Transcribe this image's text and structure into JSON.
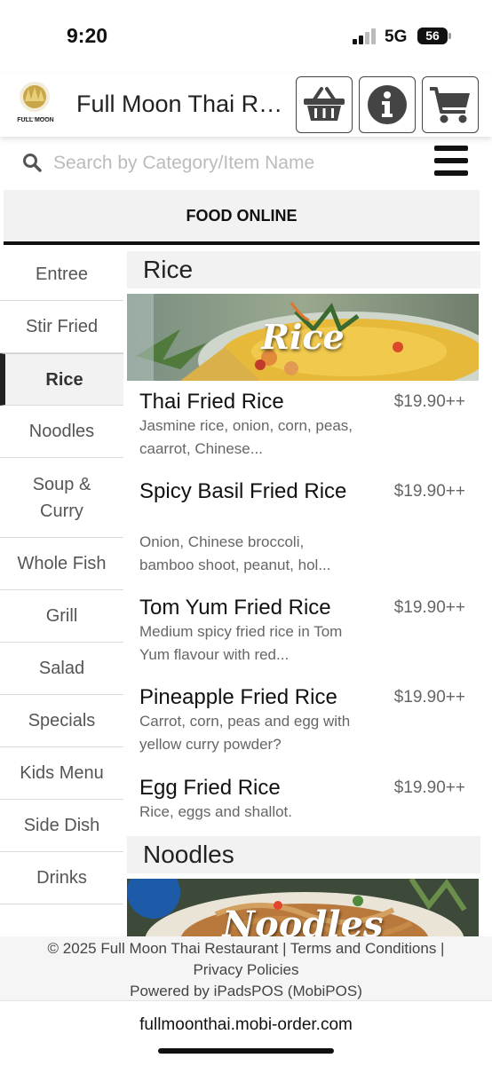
{
  "status_bar": {
    "time": "9:20",
    "network": "5G",
    "battery": "56"
  },
  "header": {
    "store_name": "Full Moon Thai Restaurant",
    "logo_text": "FULL MOON",
    "icons": [
      "basket-icon",
      "info-icon",
      "cart-icon"
    ]
  },
  "search": {
    "placeholder": "Search by Category/Item Name",
    "value": ""
  },
  "tabs": {
    "food_online": "FOOD ONLINE"
  },
  "sidebar": {
    "active": "Rice",
    "items": [
      {
        "label": "Entree"
      },
      {
        "label": "Stir Fried"
      },
      {
        "label": "Rice"
      },
      {
        "label": "Noodles"
      },
      {
        "label": "Soup & Curry"
      },
      {
        "label": "Whole Fish"
      },
      {
        "label": "Grill"
      },
      {
        "label": "Salad"
      },
      {
        "label": "Specials"
      },
      {
        "label": "Kids Menu"
      },
      {
        "label": "Side Dish"
      },
      {
        "label": "Drinks"
      }
    ]
  },
  "menu": {
    "sections": [
      {
        "title": "Rice",
        "banner_text": "Rice",
        "items": [
          {
            "name": "Thai Fried Rice",
            "price": "$19.90++",
            "desc": "Jasmine rice, onion, corn, peas, caarrot, Chinese..."
          },
          {
            "name": "Spicy Basil Fried Rice",
            "price": "$19.90++",
            "desc": "Onion, Chinese broccoli, bamboo shoot, peanut, hol..."
          },
          {
            "name": "Tom Yum Fried Rice",
            "price": "$19.90++",
            "desc": "Medium spicy fried rice in Tom Yum flavour with red..."
          },
          {
            "name": "Pineapple Fried Rice",
            "price": "$19.90++",
            "desc": "Carrot, corn, peas and egg with yellow curry powder?"
          },
          {
            "name": "Egg Fried Rice",
            "price": "$19.90++",
            "desc": "Rice, eggs and shallot."
          }
        ]
      },
      {
        "title": "Noodles",
        "banner_text": "Noodles",
        "items": []
      }
    ]
  },
  "footer": {
    "line1": "© 2025 Full Moon Thai Restaurant | Terms and Conditions |",
    "line2": "Privacy Policies",
    "line3": "Powered by iPadsPOS (MobiPOS)"
  },
  "browser": {
    "url": "fullmoonthai.mobi-order.com"
  },
  "colors": {
    "accent": "#111111",
    "panel": "#f2f2f2",
    "muted_text": "#666666"
  }
}
